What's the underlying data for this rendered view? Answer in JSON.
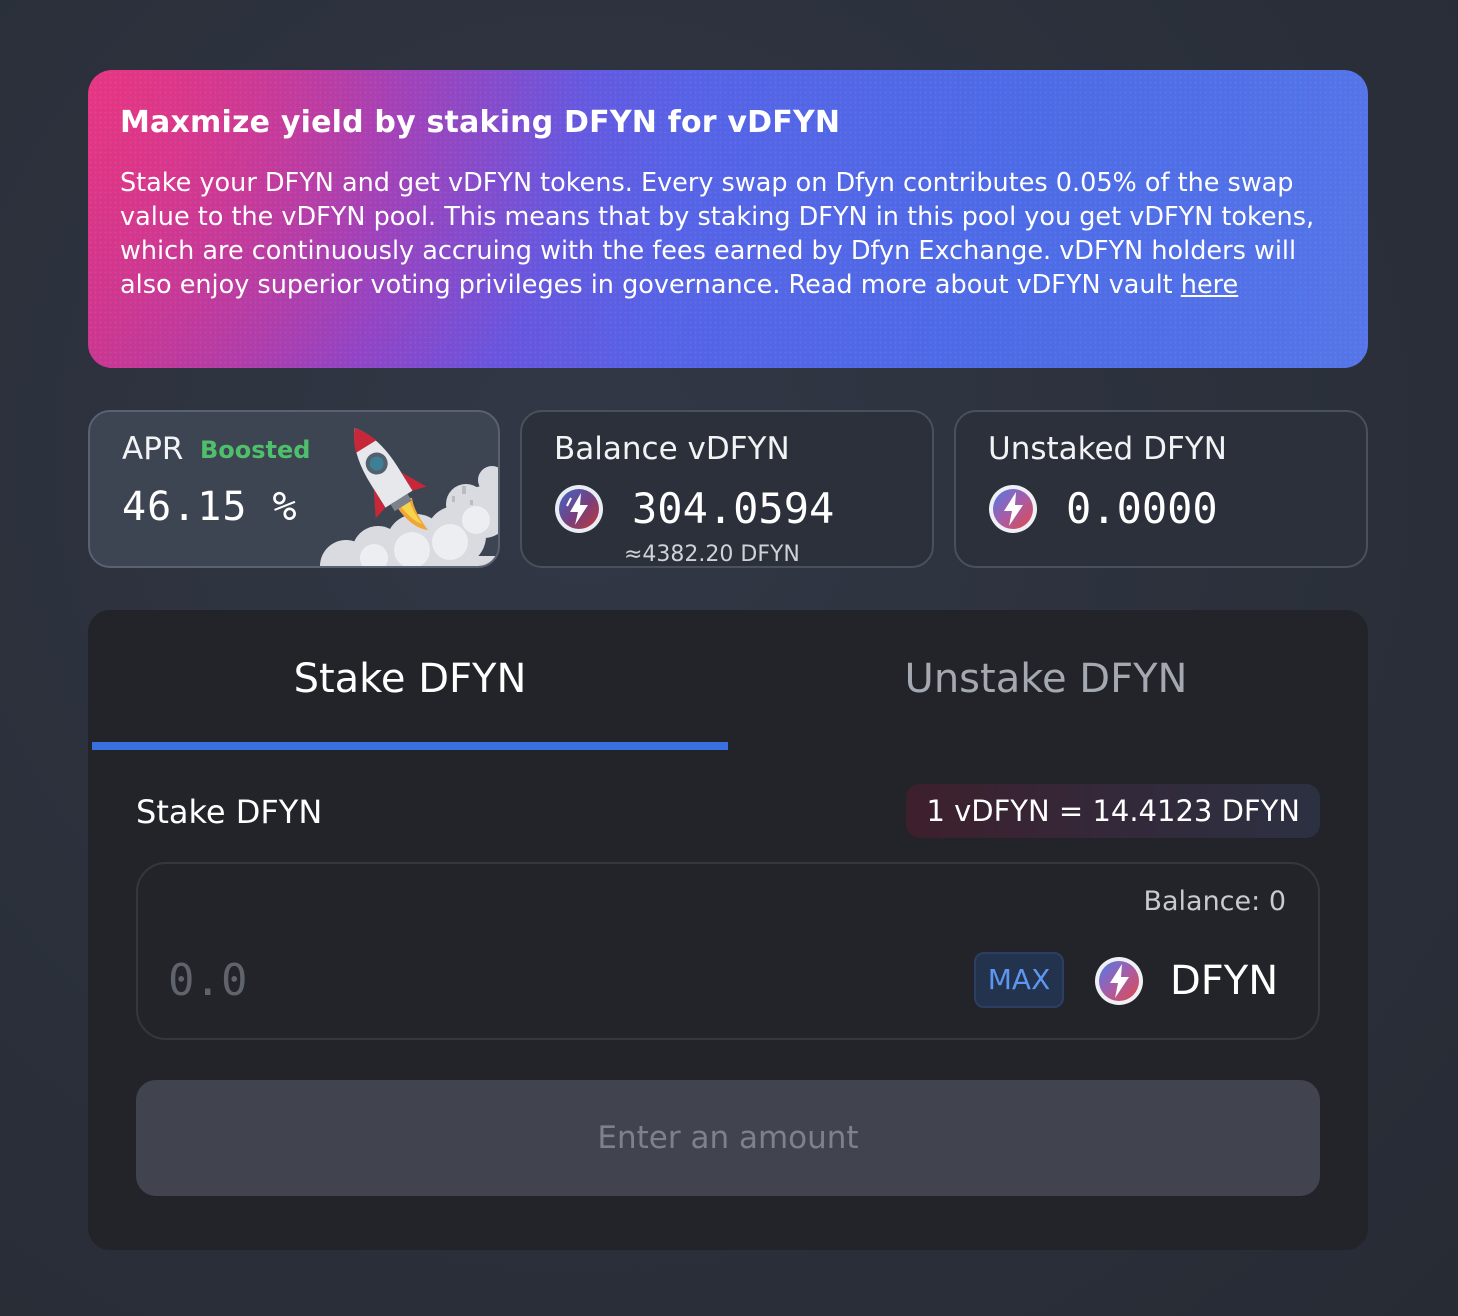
{
  "banner": {
    "title": "Maxmize yield by staking DFYN for vDFYN",
    "body": "Stake your DFYN and get vDFYN tokens. Every swap on Dfyn contributes 0.05% of the swap value to the vDFYN pool. This means that by staking DFYN in this pool you get vDFYN tokens, which are continuously accruing with the fees earned by Dfyn Exchange. vDFYN holders will also enjoy superior voting privileges in governance. Read more about vDFYN vault",
    "link_label": "here"
  },
  "stats": {
    "apr": {
      "label": "APR",
      "badge": "Boosted",
      "value": "46.15 %",
      "icon": "rocket-icon"
    },
    "balance": {
      "label": "Balance vDFYN",
      "value": "304.0594",
      "sub": "≈4382.20 DFYN",
      "icon": "vdfyn-token-icon"
    },
    "unstaked": {
      "label": "Unstaked DFYN",
      "value": "0.0000",
      "icon": "dfyn-token-icon"
    }
  },
  "panel": {
    "tabs": [
      {
        "label": "Stake DFYN",
        "active": true
      },
      {
        "label": "Unstake DFYN",
        "active": false
      }
    ],
    "section_label": "Stake DFYN",
    "rate": "1 vDFYN = 14.4123 DFYN",
    "input": {
      "balance": "Balance: 0",
      "value": "",
      "placeholder": "0.0",
      "max_label": "MAX",
      "token": "DFYN",
      "token_icon": "dfyn-token-icon"
    },
    "submit_label": "Enter an amount"
  },
  "colors": {
    "background": "#2b303b",
    "accent": "#3a6fe0",
    "boosted": "#4fbf6b",
    "max": "#5d96f0"
  }
}
